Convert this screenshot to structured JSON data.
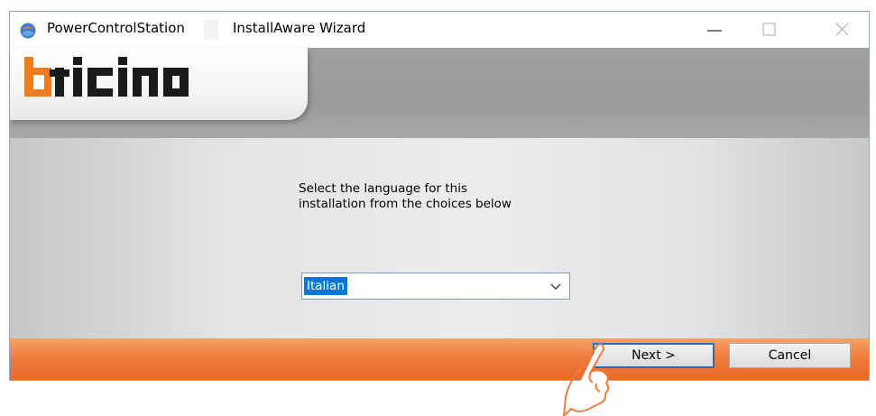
{
  "window": {
    "app_name": "PowerControlStation",
    "wizard_name": "InstallAware Wizard",
    "controls": {
      "minimize_icon": "minimize-icon",
      "maximize_icon": "maximize-icon",
      "close_icon": "close-icon"
    }
  },
  "header": {
    "logo_text": "bticino",
    "logo_accent_color": "#f07c1e"
  },
  "content": {
    "prompt": "Select the language for this\ninstallation from the choices below",
    "language_select": {
      "selected": "Italian"
    }
  },
  "footer": {
    "next_label": "Next >",
    "cancel_label": "Cancel",
    "accent_color": "#ee7d3c"
  }
}
